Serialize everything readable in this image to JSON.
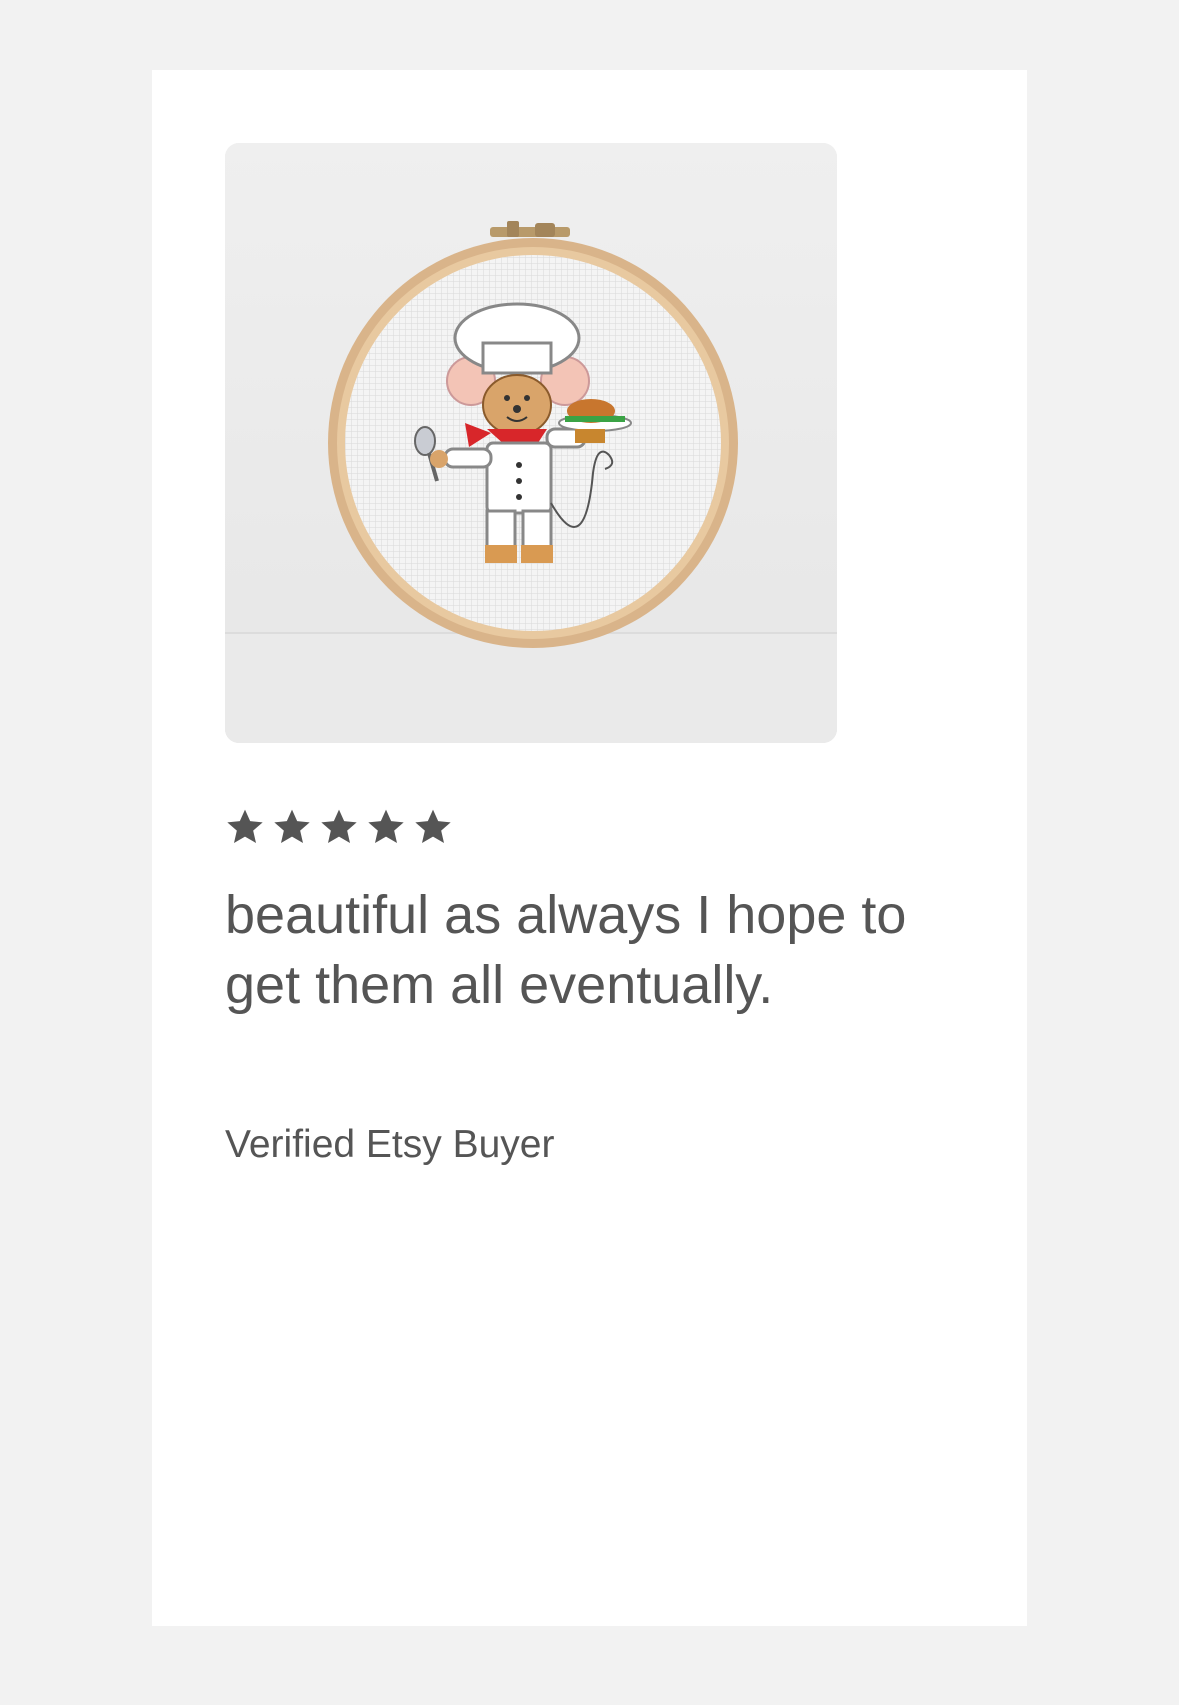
{
  "colors": {
    "page_background": "#f2f2f2",
    "card_background": "#ffffff",
    "text": "#555555",
    "star": "#555555"
  },
  "product_image": {
    "subject_icon": "cross-stitch-chef-mouse-in-hoop"
  },
  "review": {
    "rating": 5,
    "rating_max": 5,
    "star_icon": "star-icon",
    "text": "beautiful as always I hope to get them all eventually.",
    "reviewer": "Verified Etsy Buyer"
  }
}
